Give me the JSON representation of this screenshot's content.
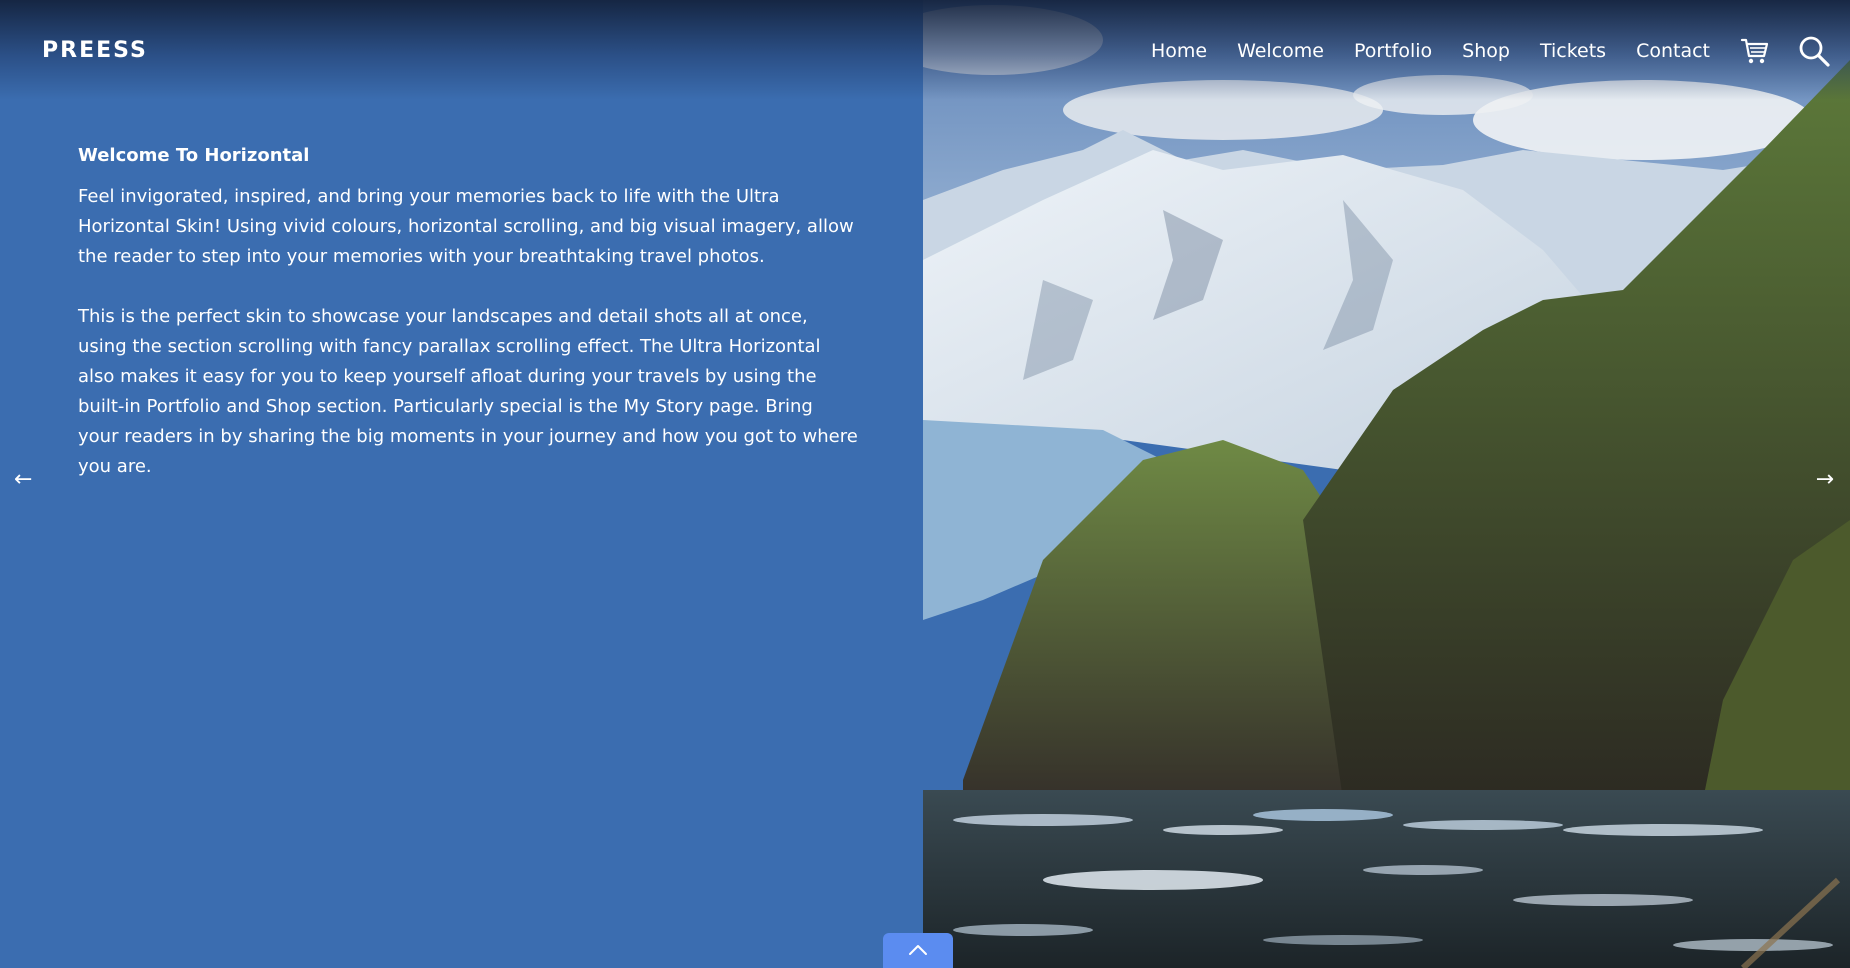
{
  "site": {
    "logo": "PREESS"
  },
  "nav": {
    "items": [
      {
        "label": "Home"
      },
      {
        "label": "Welcome"
      },
      {
        "label": "Portfolio"
      },
      {
        "label": "Shop"
      },
      {
        "label": "Tickets"
      },
      {
        "label": "Contact"
      }
    ],
    "cart_icon": "cart-icon",
    "search_icon": "search-icon"
  },
  "main": {
    "heading": "Welcome To Horizontal",
    "paragraph_1": "Feel invigorated, inspired, and bring your memories back to life with the Ultra Horizontal Skin! Using vivid colours, horizontal scrolling, and big visual imagery, allow the reader to step into your memories with your breathtaking travel photos.",
    "paragraph_2": "This is the perfect skin to showcase your landscapes and detail shots all at once, using the section scrolling with fancy parallax scrolling effect. The Ultra Horizontal also makes it easy for you to keep yourself afloat during your travels by using the built-in Portfolio and Shop section. Particularly special is the My Story page. Bring your readers in by sharing the big moments in your journey and how you got to where you are."
  },
  "controls": {
    "prev_arrow": "←",
    "next_arrow": "→",
    "scroll_top_icon": "chevron-up-icon"
  },
  "colors": {
    "panel_bg": "#3b6db0",
    "scroll_top_bg": "#5b8cf0",
    "text": "#ffffff"
  }
}
